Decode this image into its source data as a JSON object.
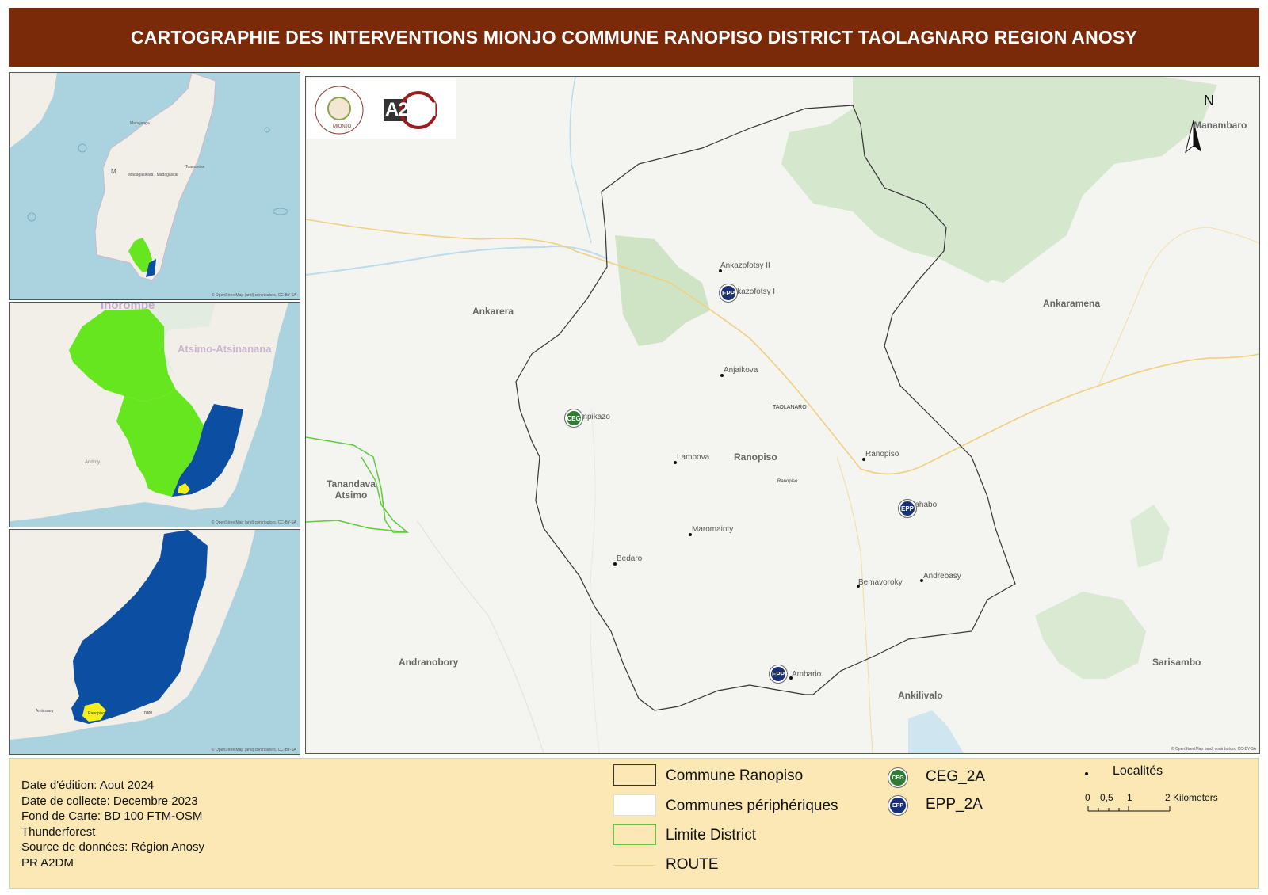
{
  "title": "CARTOGRAPHIE DES INTERVENTIONS MIONJO COMMUNE RANOPISO  DISTRICT TAOLAGNARO REGION ANOSY",
  "insets": {
    "madagascar": {
      "labels": [
        "Mahajanga",
        "Madagasikara / Madagascar",
        "M",
        "Toamasina"
      ],
      "attribution": "© OpenStreetMap (and) contributors, CC-BY-SA"
    },
    "region": {
      "labels": [
        "Ihorombe",
        "Atsimo-Atsinanana",
        "Androy"
      ],
      "attribution": "© OpenStreetMap (and) contributors, CC-BY-SA"
    },
    "district": {
      "labels": [
        "Ambosary",
        "Ranopiso",
        "naro"
      ],
      "attribution": "© OpenStreetMap (and) contributors, CC-BY-SA"
    }
  },
  "logos": {
    "mionjo": "MIONJO",
    "a2dm": "A2DM"
  },
  "main_map": {
    "north_label": "N",
    "attribution": "© OpenStreetMap (and) contributors, CC-BY-SA",
    "communes": [
      {
        "name": "Ankarera"
      },
      {
        "name": "Ankaramena"
      },
      {
        "name": "Tanandava Atsimo"
      },
      {
        "name": "Ranopiso"
      },
      {
        "name": "Andranobory"
      },
      {
        "name": "Ankilivalo"
      },
      {
        "name": "Sarisambo"
      },
      {
        "name": "Manambaro"
      }
    ],
    "localites": [
      {
        "name": "Ankazofotsy II"
      },
      {
        "name": "Ankazofotsy I"
      },
      {
        "name": "Anjaikova"
      },
      {
        "name": "Ampikazo"
      },
      {
        "name": "Lambova"
      },
      {
        "name": "Ranopiso"
      },
      {
        "name": "Mahabo"
      },
      {
        "name": "Maromainty"
      },
      {
        "name": "Bedaro"
      },
      {
        "name": "Bemavoroky"
      },
      {
        "name": "Andrebasy"
      },
      {
        "name": "Ambario"
      }
    ],
    "small_labels": [
      "TAOLANARO",
      "Ranopiso"
    ],
    "markers": [
      {
        "type": "EPP",
        "label": "EPP",
        "site": "Ankazofotsy I"
      },
      {
        "type": "CEG",
        "label": "CEG",
        "site": "Ampikazo"
      },
      {
        "type": "EPP",
        "label": "EPP",
        "site": "Mahabo"
      },
      {
        "type": "EPP",
        "label": "EPP",
        "site": "Ambario"
      }
    ]
  },
  "legend": {
    "meta": [
      "Date d'édition: Aout 2024",
      "Date de collecte: Decembre 2023",
      "Fond de Carte: BD 100 FTM-OSM",
      "Thunderforest",
      "Source de données: Région Anosy",
      "PR A2DM"
    ],
    "items": {
      "commune": "Commune Ranopiso",
      "peripheral": "Communes périphériques",
      "district": "Limite District",
      "route": "ROUTE",
      "ceg": "CEG_2A",
      "epp": "EPP_2A",
      "localites": "Localités"
    },
    "scale": {
      "ticks": [
        "0",
        "0,5",
        "1",
        "2 Kilometers"
      ]
    }
  },
  "colors": {
    "title_bg": "#7a2a08",
    "legend_bg": "#fbe8b4",
    "water": "#aad3df",
    "land": "#f2efe9",
    "green_commune": "#66e61f",
    "blue_district": "#0b4ea2",
    "yellow_ranopiso": "#f4ee1c",
    "forest": "#cfe5c3",
    "ceg": "#2e7d32",
    "epp": "#1a2f7a",
    "route": "#f0d080",
    "district_line": "#5ecb3c"
  }
}
